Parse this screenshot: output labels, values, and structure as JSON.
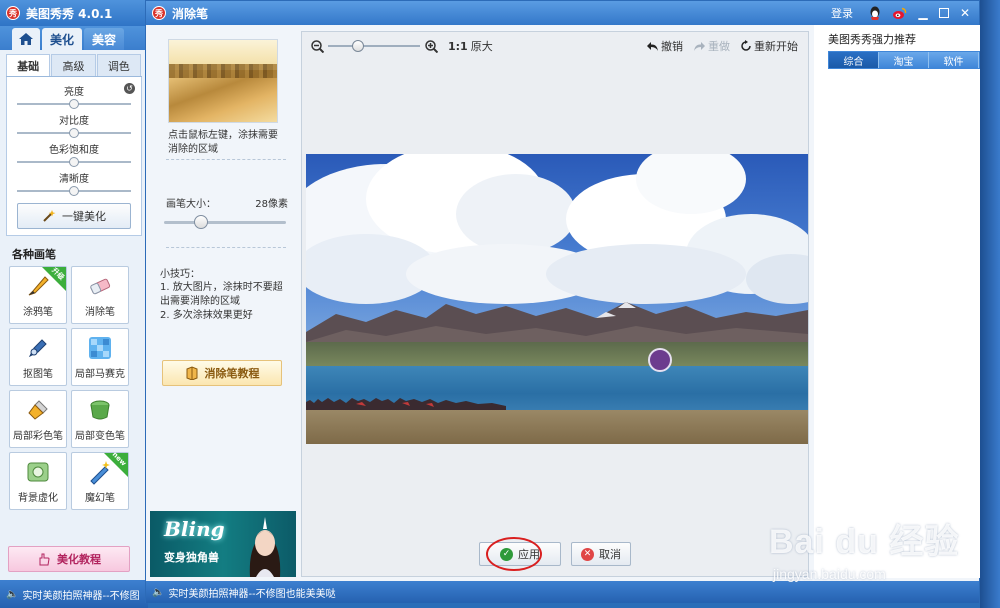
{
  "background_app": {
    "title": "美图秀秀 4.0.1",
    "logo_text": "秀",
    "tabs": [
      {
        "label": "",
        "icon": "home-icon"
      },
      {
        "label": "美化"
      },
      {
        "label": "美容"
      }
    ],
    "subtabs": [
      "基础",
      "高级",
      "调色"
    ],
    "adjustments": [
      {
        "label": "亮度",
        "level": 0.5
      },
      {
        "label": "对比度",
        "level": 0.5
      },
      {
        "label": "色彩饱和度",
        "level": 0.5
      },
      {
        "label": "清晰度",
        "level": 0.5
      }
    ],
    "one_click_label": "一键美化",
    "brushes_title": "各种画笔",
    "brushes": [
      {
        "label": "涂鸦笔",
        "icon": "doodle-pen-icon",
        "badge": "升级"
      },
      {
        "label": "消除笔",
        "icon": "eraser-icon",
        "badge": ""
      },
      {
        "label": "抠图笔",
        "icon": "cutout-pen-icon",
        "badge": ""
      },
      {
        "label": "局部马赛克",
        "icon": "mosaic-icon",
        "badge": ""
      },
      {
        "label": "局部彩色笔",
        "icon": "color-brush-icon",
        "badge": ""
      },
      {
        "label": "局部变色笔",
        "icon": "recolor-bucket-icon",
        "badge": ""
      },
      {
        "label": "背景虚化",
        "icon": "background-blur-icon",
        "badge": ""
      },
      {
        "label": "魔幻笔",
        "icon": "magic-pen-icon",
        "badge": "new"
      }
    ],
    "tutorial_label": "美化教程",
    "status_text": "实时美颜拍照神器--不修图"
  },
  "dialog": {
    "title": "消除笔",
    "logo_text": "秀",
    "login_label": "登录",
    "instruction": "点击鼠标左键，涂抹需要消除的区域",
    "brush_size_label": "画笔大小：",
    "brush_size_value": "28像素",
    "brush_size_level": 0.28,
    "tips_title": "小技巧：",
    "tips": [
      "1. 放大图片，涂抹时不要超出需要消除的区域",
      "2. 多次涂抹效果更好"
    ],
    "tutorial_label": "消除笔教程",
    "ad_title": "Bling",
    "ad_subtitle": "变身独角兽",
    "zoom_level": 0.3,
    "ratio_label": "1:1",
    "original_size_label": "原大",
    "undo_label": "撤销",
    "redo_label": "重做",
    "restart_label": "重新开始",
    "apply_label": "应用",
    "cancel_label": "取消",
    "reco_title": "美图秀秀强力推荐",
    "reco_tabs": [
      "综合",
      "淘宝",
      "软件"
    ],
    "status_text": "实时美颜拍照神器--不修图也能美美哒"
  },
  "watermark": {
    "text": "Bai du 经验",
    "url": "jingyan.baidu.com"
  },
  "colors": {
    "titlebar": "#3478c9",
    "accent_blue": "#3f86d8",
    "apply_ring": "#d91f1f",
    "brush_cursor": "#6c3c8e",
    "badge_green": "#3cae3c"
  }
}
